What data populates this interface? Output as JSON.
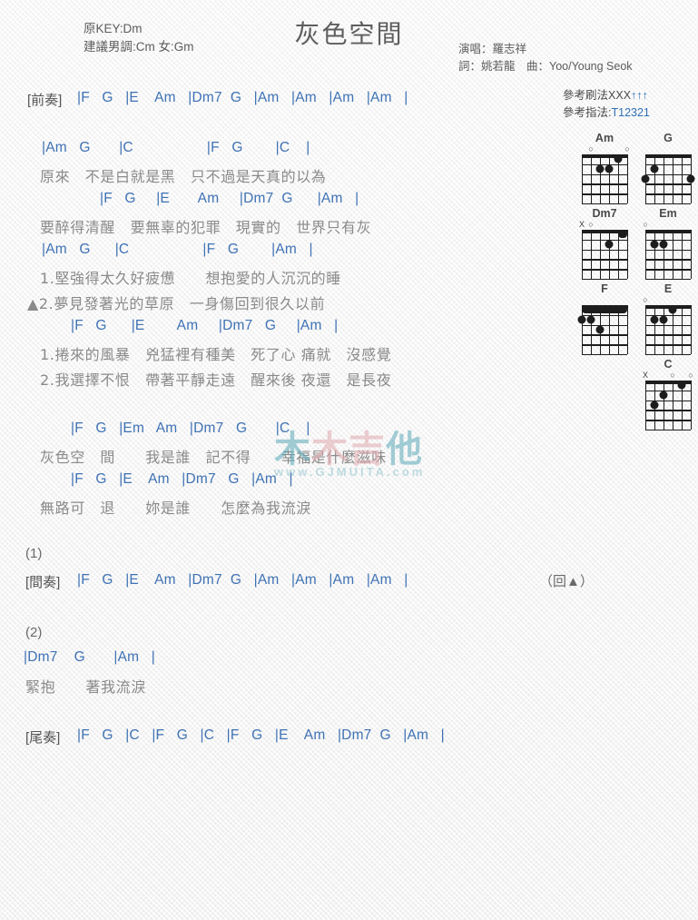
{
  "header": {
    "title": "灰色空間",
    "key_original": "原KEY:Dm",
    "key_suggest": "建議男調:Cm 女:Gm",
    "singer": "演唱：羅志祥",
    "writers": "詞：姚若龍　曲：Yoo/Young Seok",
    "strum_label": "參考刷法",
    "strum_pattern": "XXX",
    "strum_arrows": "↑↑↑",
    "finger_label": "參考指法:",
    "finger_pattern": "T12321"
  },
  "watermark": {
    "char1": "木",
    "char2": "木",
    "char3": "吉",
    "char4": "他",
    "site": "www.GJMUITA.com",
    "color_teal": "#5aa8b8",
    "color_pink": "#e0a8ae"
  },
  "sections": {
    "intro_label": "[前奏]",
    "intro_chords": "|F   G   |E    Am   |Dm7  G   |Am   |Am   |Am   |Am   |",
    "interlude_label": "[間奏]",
    "interlude_chords": "|F   G   |E    Am   |Dm7  G   |Am   |Am   |Am   |Am   |",
    "interlude_return": "（回▲）",
    "outro_label": "[尾奏]",
    "outro_chords": "|F   G   |C   |F   G   |C   |F   G   |E    Am   |Dm7  G   |Am   |",
    "repeat_1": "(1)",
    "repeat_2": "(2)"
  },
  "verses": [
    {
      "chords": "|Am   G       |C                  |F   G        |C    |",
      "lyrics": [
        "原來　不是白就是黑　只不過是天真的以為"
      ]
    },
    {
      "chords": "|F   G     |E       Am     |Dm7  G      |Am   |",
      "lyrics": [
        "要醉得清醒　要無辜的犯罪　現實的　世界只有灰"
      ]
    },
    {
      "chords": "|Am   G      |C                  |F   G        |Am   |",
      "lyrics": [
        "1.堅強得太久好疲憊　　想抱愛的人沉沉的睡",
        "▲2.夢見發著光的草原　一身傷回到很久以前"
      ]
    },
    {
      "chords": "|F   G      |E        Am     |Dm7   G     |Am   |",
      "lyrics": [
        "1.捲來的風暴　兇猛裡有種美　死了心 痛就　沒感覺",
        "2.我選擇不恨　帶著平靜走遠　醒來後 夜還　是長夜"
      ]
    }
  ],
  "chorus": [
    {
      "chords": "|F   G   |Em   Am   |Dm7   G       |C    |",
      "lyrics": [
        "灰色空　間　　我是誰　記不得　　幸福是什麼滋味"
      ]
    },
    {
      "chords": "|F   G   |E    Am   |Dm7   G   |Am   |",
      "lyrics": [
        "無路可　退　　妳是誰　　怎麼為我流淚"
      ]
    }
  ],
  "bridge": {
    "chords": "|Dm7    G       |Am   |",
    "lyrics": [
      "緊抱　　著我流淚"
    ]
  },
  "chord_diagrams": [
    {
      "name": "Am",
      "markers": [
        {
          "string": 5,
          "symbol": "○"
        },
        {
          "string": 1,
          "symbol": "○"
        }
      ],
      "dots": [
        {
          "string": 4,
          "fret": 2
        },
        {
          "string": 3,
          "fret": 2
        },
        {
          "string": 2,
          "fret": 1
        }
      ],
      "barre": null
    },
    {
      "name": "G",
      "markers": [],
      "dots": [
        {
          "string": 5,
          "fret": 2
        },
        {
          "string": 6,
          "fret": 3
        },
        {
          "string": 1,
          "fret": 3
        }
      ],
      "barre": null
    },
    {
      "name": "Dm7",
      "markers": [
        {
          "string": 6,
          "symbol": "X"
        },
        {
          "string": 5,
          "symbol": "○"
        }
      ],
      "dots": [
        {
          "string": 3,
          "fret": 2
        }
      ],
      "barre": {
        "fret": 1,
        "from": 1,
        "to": 2
      }
    },
    {
      "name": "Em",
      "markers": [
        {
          "string": 6,
          "symbol": "○"
        }
      ],
      "dots": [
        {
          "string": 5,
          "fret": 2
        },
        {
          "string": 4,
          "fret": 2
        }
      ],
      "barre": null
    },
    {
      "name": "F",
      "markers": [],
      "dots": [
        {
          "string": 4,
          "fret": 3
        },
        {
          "string": 6,
          "fret": 2
        },
        {
          "string": 5,
          "fret": 2
        }
      ],
      "barre": {
        "fret": 1,
        "from": 1,
        "to": 6
      }
    },
    {
      "name": "E",
      "markers": [
        {
          "string": 6,
          "symbol": "○"
        }
      ],
      "dots": [
        {
          "string": 3,
          "fret": 1
        },
        {
          "string": 5,
          "fret": 2
        },
        {
          "string": 4,
          "fret": 2
        }
      ],
      "barre": null
    },
    {
      "name": "C",
      "markers": [
        {
          "string": 6,
          "symbol": "X"
        },
        {
          "string": 3,
          "symbol": "○"
        },
        {
          "string": 1,
          "symbol": "○"
        }
      ],
      "dots": [
        {
          "string": 2,
          "fret": 1
        },
        {
          "string": 4,
          "fret": 2
        },
        {
          "string": 5,
          "fret": 3
        }
      ],
      "barre": null
    }
  ]
}
